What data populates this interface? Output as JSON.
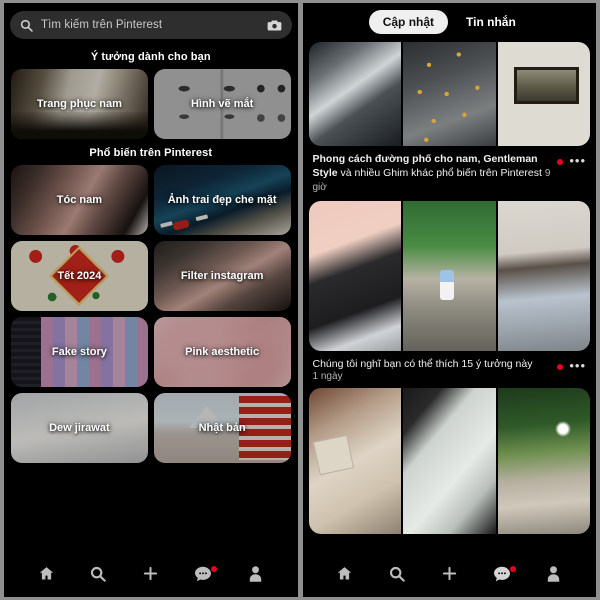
{
  "app": {
    "name": "Pinterest"
  },
  "left_panel": {
    "search": {
      "placeholder": "Tìm kiếm trên Pinterest",
      "search_icon": "search-icon",
      "camera_icon": "camera-icon"
    },
    "sections": [
      {
        "title": "Ý tưởng dành cho bạn",
        "cards": [
          {
            "label": "Trang phục nam",
            "art": "art-trangphuc"
          },
          {
            "label": "Hình vẽ mắt",
            "art": "art-hinhve"
          }
        ]
      },
      {
        "title": "Phổ biến trên Pinterest",
        "cards": [
          {
            "label": "Tóc nam",
            "art": "art-tocnam"
          },
          {
            "label": "Ảnh trai đẹp che mặt",
            "art": "art-anhtrai"
          },
          {
            "label": "Tết 2024",
            "art": "art-tet"
          },
          {
            "label": "Filter instagram",
            "art": "art-filter"
          },
          {
            "label": "Fake story",
            "art": "art-fake"
          },
          {
            "label": "Pink aesthetic",
            "art": "art-pink"
          },
          {
            "label": "Dew jirawat",
            "art": "art-dew"
          },
          {
            "label": "Nhật bản",
            "art": "art-nhatban"
          }
        ]
      }
    ],
    "bottom_nav": [
      {
        "name": "home",
        "icon": "home-icon",
        "badge": false
      },
      {
        "name": "search",
        "icon": "search-icon",
        "badge": false
      },
      {
        "name": "create",
        "icon": "plus-icon",
        "badge": false
      },
      {
        "name": "messages",
        "icon": "chat-bubble-icon",
        "badge": true
      },
      {
        "name": "profile",
        "icon": "person-icon",
        "badge": false
      }
    ]
  },
  "right_panel": {
    "tabs": [
      {
        "label": "Cập nhật",
        "active": true
      },
      {
        "label": "Tin nhắn",
        "active": false
      }
    ],
    "notifications": [
      {
        "title_bold_1": "Phong cách đường phố cho nam, Gentleman Style",
        "title_plain": " và nhiều Ghim khác phổ biến trên Pinterest ",
        "time": "9 giờ",
        "unread": true,
        "more_icon": "ellipsis-icon",
        "thumbs": [
          "t-waves",
          "t-leaves",
          "t-frame"
        ]
      },
      {
        "title_bold_1": "",
        "title_plain": "Chúng tôi nghĩ bạn có thể thích 15 ý tưởng này",
        "time": "1 ngày",
        "unread": true,
        "more_icon": "ellipsis-icon",
        "thumbs": [
          "t-outfit1",
          "t-outfit2",
          "t-outfit3"
        ]
      },
      {
        "title_bold_1": "",
        "title_plain": "",
        "time": "",
        "unread": false,
        "more_icon": "ellipsis-icon",
        "thumbs": [
          "t-dress",
          "t-cloth",
          "t-park"
        ]
      }
    ],
    "bottom_nav": [
      {
        "name": "home",
        "icon": "home-icon",
        "badge": false
      },
      {
        "name": "search",
        "icon": "search-icon",
        "badge": false
      },
      {
        "name": "create",
        "icon": "plus-icon",
        "badge": false
      },
      {
        "name": "messages",
        "icon": "chat-bubble-icon",
        "badge": true
      },
      {
        "name": "profile",
        "icon": "person-icon",
        "badge": false
      }
    ]
  },
  "colors": {
    "background": "#000000",
    "accent_red": "#e60023",
    "search_bg": "#2e2e2e",
    "tab_active_bg": "#efefef"
  }
}
